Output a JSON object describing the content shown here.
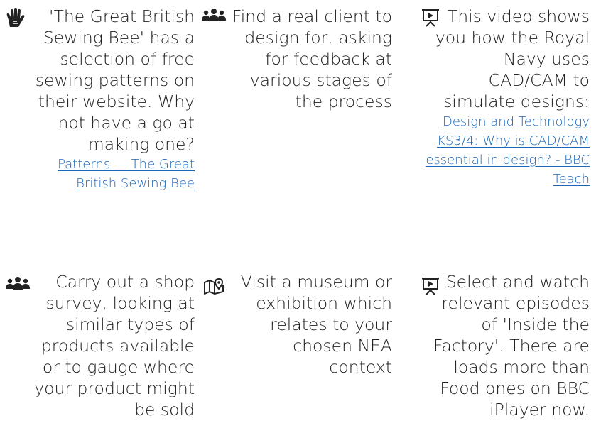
{
  "activities": [
    {
      "icon": "sign-language-hand-icon",
      "text": "'The Great British Sewing Bee' has a selection of free sewing patterns on their website. Why not have a go at making one?",
      "link": "Patterns — The Great British Sewing Bee"
    },
    {
      "icon": "people-group-icon",
      "text": "Find a real client to design for, asking for feedback at various stages of the process",
      "link": ""
    },
    {
      "icon": "presentation-video-icon",
      "text": "This video shows you how the Royal Navy uses CAD/CAM to simulate designs:",
      "link": "Design and Technology KS3/4: Why is CAD/CAM essential in design? - BBC Teach"
    },
    {
      "icon": "people-group-icon",
      "text": "Carry out a shop survey, looking at similar types of products available or to gauge where your product might be sold",
      "link": ""
    },
    {
      "icon": "map-pin-icon",
      "text": "Visit a museum or exhibition which relates to your chosen NEA context",
      "link": ""
    },
    {
      "icon": "presentation-video-icon",
      "text": "Select and watch relevant episodes of 'Inside the Factory'. There are loads more than Food ones on BBC iPlayer now.",
      "link": ""
    }
  ]
}
